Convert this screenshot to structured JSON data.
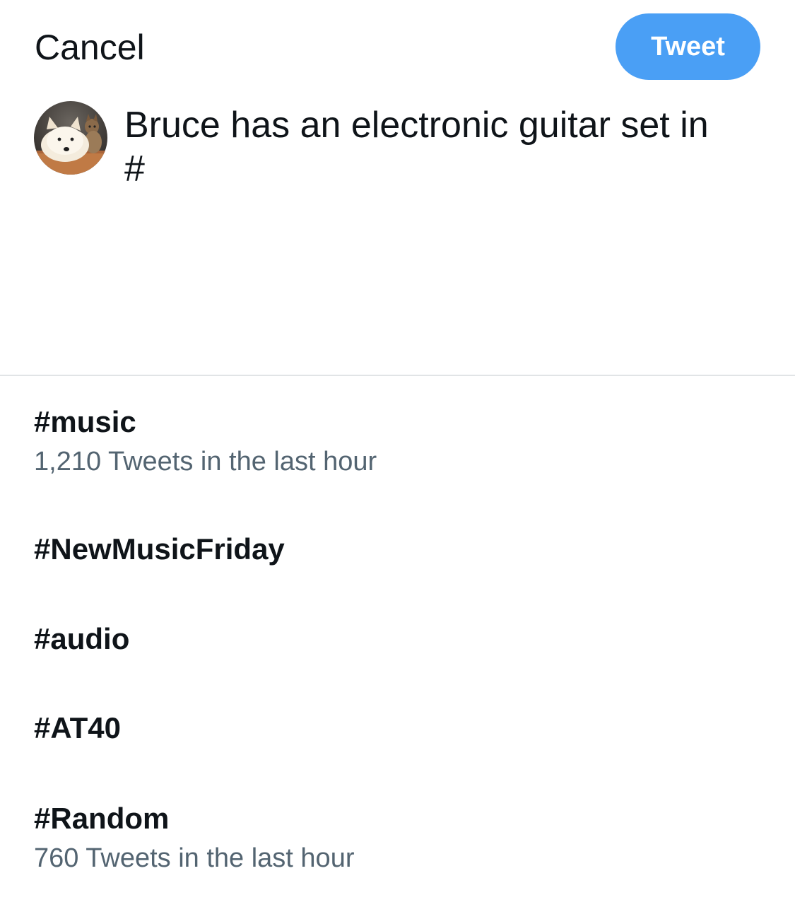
{
  "header": {
    "cancel_label": "Cancel",
    "tweet_label": "Tweet",
    "accent_color": "#4a9ff5"
  },
  "composer": {
    "avatar_icon": "profile-avatar-dog-and-cat",
    "text": "Bruce has an electronic guitar set in\n#"
  },
  "suggestions": [
    {
      "tag": "#music",
      "meta": "1,210 Tweets in the last hour"
    },
    {
      "tag": "#NewMusicFriday",
      "meta": ""
    },
    {
      "tag": "#audio",
      "meta": ""
    },
    {
      "tag": "#AT40",
      "meta": ""
    },
    {
      "tag": "#Random",
      "meta": "760 Tweets in the last hour"
    }
  ]
}
